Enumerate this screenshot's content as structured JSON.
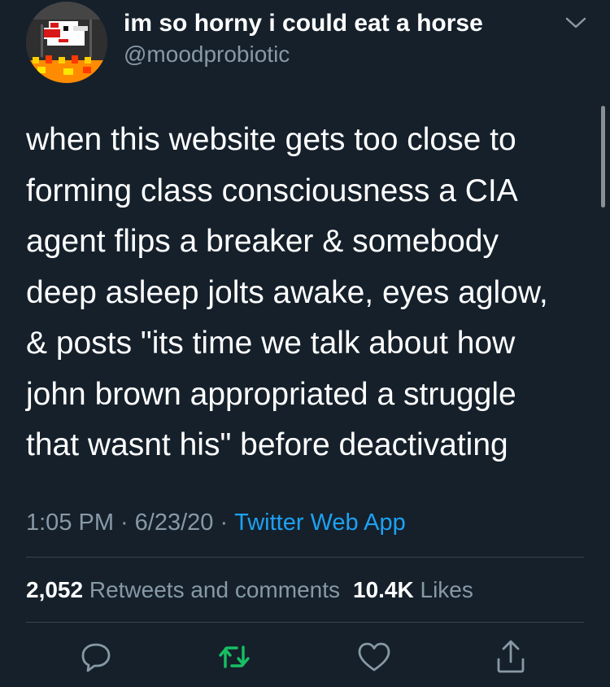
{
  "tweet": {
    "display_name": "im so horny i could eat a horse",
    "handle": "@moodprobiotic",
    "text_lines": [
      "when this website gets too close to",
      "forming class consciousness a CIA",
      "agent flips a breaker & somebody",
      "deep asleep jolts awake, eyes aglow,",
      "& posts \"its time we talk about how",
      "john brown appropriated a struggle",
      "that wasnt his\" before deactivating"
    ],
    "time": "1:05 PM",
    "date": "6/23/20",
    "separator": "·",
    "source": "Twitter Web App"
  },
  "stats": {
    "retweets_count": "2,052",
    "retweets_label": "Retweets and comments",
    "likes_count": "10.4K",
    "likes_label": "Likes"
  },
  "icons": {
    "caret": "chevron-down-icon",
    "reply": "comment-icon",
    "retweet": "retweet-icon",
    "like": "heart-icon",
    "share": "share-icon"
  },
  "colors": {
    "background": "#15202b",
    "secondary_text": "#8899a6",
    "link": "#1da1f2",
    "retweet_green": "#17bf63",
    "divider": "#38444d"
  }
}
